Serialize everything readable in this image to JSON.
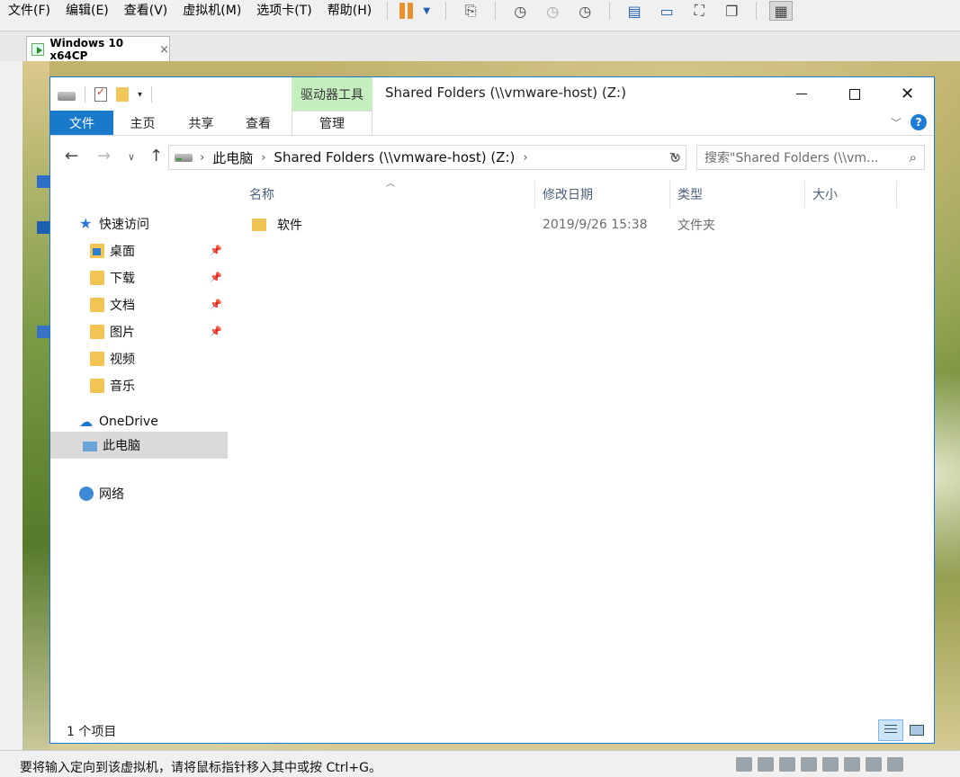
{
  "vm": {
    "menu": [
      "文件(F)",
      "编辑(E)",
      "查看(V)",
      "虚拟机(M)",
      "选项卡(T)",
      "帮助(H)"
    ],
    "tab_label": "Windows 10 x64CP",
    "tab_close": "×",
    "status_text": "要将输入定向到该虚拟机，请将鼠标指针移入其中或按 Ctrl+G。",
    "accent_pause": "#e8912c"
  },
  "explorer": {
    "contextual_header": "驱动器工具",
    "title": "Shared Folders (\\\\vmware-host) (Z:)",
    "ribbon_tabs": {
      "file": "文件",
      "home": "主页",
      "share": "共享",
      "view": "查看",
      "manage": "管理"
    },
    "controls": {
      "close": "✕"
    },
    "address": {
      "crumb1": "此电脑",
      "crumb2": "Shared Folders (\\\\vmware-host) (Z:)"
    },
    "search_placeholder": "搜索\"Shared Folders (\\\\vm...",
    "nav": {
      "quick_access": "快速访问",
      "desktop": "桌面",
      "downloads": "下载",
      "documents": "文档",
      "pictures": "图片",
      "videos": "视频",
      "music": "音乐",
      "onedrive": "OneDrive",
      "this_pc": "此电脑",
      "network": "网络"
    },
    "columns": {
      "name": "名称",
      "date": "修改日期",
      "type": "类型",
      "size": "大小"
    },
    "files": [
      {
        "name": "软件",
        "date": "2019/9/26 15:38",
        "type": "文件夹",
        "size": ""
      }
    ],
    "status": {
      "item_count": "1 个项目"
    },
    "colors": {
      "file_tab": "#1979ca",
      "contextual": "#c6efc0",
      "selected_nav": "#d9d9d9"
    }
  }
}
